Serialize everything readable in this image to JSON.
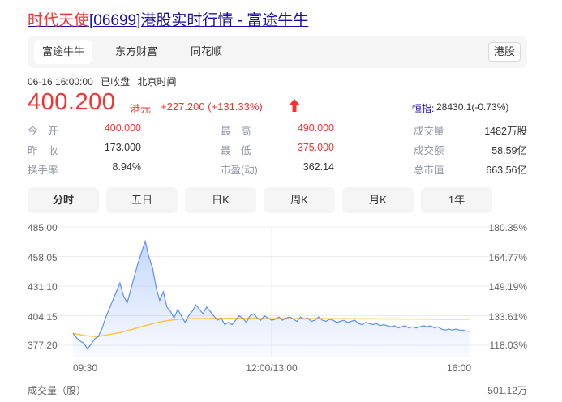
{
  "header": {
    "title_highlight": "时代天使",
    "title_rest": "[06699]港股实时行情 - 富途牛牛"
  },
  "source_tabs": [
    {
      "label": "富途牛牛",
      "active": true
    },
    {
      "label": "东方财富",
      "active": false
    },
    {
      "label": "同花顺",
      "active": false
    }
  ],
  "market_badge": "港股",
  "status": {
    "datetime": "06-16 16:00:00",
    "state": "已收盘",
    "timezone": "北京时间"
  },
  "quote": {
    "price": "400.200",
    "currency": "港元",
    "change": "+227.200 (+131.33%)",
    "direction": "up"
  },
  "index": {
    "label": "恒指:",
    "value": "28430.1(-0.73%)"
  },
  "stats": [
    {
      "label": "今　开",
      "value": "400.000",
      "red": true
    },
    {
      "label": "最　高",
      "value": "490.000",
      "red": true
    },
    {
      "label": "成交量",
      "value": "1482万股",
      "red": false
    },
    {
      "label": "昨　收",
      "value": "173.000",
      "red": false
    },
    {
      "label": "最　低",
      "value": "375.000",
      "red": true
    },
    {
      "label": "成交额",
      "value": "58.59亿",
      "red": false
    },
    {
      "label": "换手率",
      "value": "8.94%",
      "red": false
    },
    {
      "label": "市盈(动)",
      "value": "362.14",
      "red": false
    },
    {
      "label": "总市值",
      "value": "663.56亿",
      "red": false
    }
  ],
  "period_tabs": [
    {
      "label": "分时",
      "active": true
    },
    {
      "label": "五日",
      "active": false
    },
    {
      "label": "日K",
      "active": false
    },
    {
      "label": "周K",
      "active": false
    },
    {
      "label": "月K",
      "active": false
    },
    {
      "label": "1年",
      "active": false
    }
  ],
  "colors": {
    "up": "#f73131",
    "link": "#1a0dab",
    "price_line": "#5b8ff9",
    "avg_line": "#ffc53d"
  },
  "chart_data": {
    "type": "line",
    "y_left_ticks": [
      "485.00",
      "458.05",
      "431.10",
      "404.15",
      "377.20"
    ],
    "y_right_ticks": [
      "180.35%",
      "164.77%",
      "149.19%",
      "133.61%",
      "118.03%"
    ],
    "x_ticks": [
      "09:30",
      "12:00/13:00",
      "16:00"
    ],
    "ylim": [
      377.2,
      485.0
    ],
    "x_range": [
      0,
      330
    ],
    "grid": true,
    "volume_label": "成交量（股）",
    "volume_max": "501.12万",
    "series": [
      {
        "role": "price",
        "points": [
          [
            0,
            388
          ],
          [
            3,
            384
          ],
          [
            6,
            381
          ],
          [
            9,
            379
          ],
          [
            12,
            374
          ],
          [
            15,
            378
          ],
          [
            18,
            383
          ],
          [
            21,
            385
          ],
          [
            24,
            392
          ],
          [
            27,
            402
          ],
          [
            30,
            410
          ],
          [
            33,
            418
          ],
          [
            36,
            426
          ],
          [
            39,
            434
          ],
          [
            42,
            422
          ],
          [
            45,
            416
          ],
          [
            48,
            428
          ],
          [
            51,
            440
          ],
          [
            54,
            452
          ],
          [
            57,
            462
          ],
          [
            60,
            472
          ],
          [
            63,
            458
          ],
          [
            66,
            448
          ],
          [
            69,
            430
          ],
          [
            72,
            418
          ],
          [
            75,
            426
          ],
          [
            78,
            412
          ],
          [
            81,
            408
          ],
          [
            84,
            402
          ],
          [
            87,
            410
          ],
          [
            90,
            404
          ],
          [
            93,
            398
          ],
          [
            96,
            404
          ],
          [
            99,
            408
          ],
          [
            102,
            414
          ],
          [
            105,
            410
          ],
          [
            108,
            406
          ],
          [
            111,
            412
          ],
          [
            114,
            408
          ],
          [
            117,
            404
          ],
          [
            120,
            400
          ],
          [
            123,
            402
          ],
          [
            126,
            396
          ],
          [
            129,
            398
          ],
          [
            132,
            396
          ],
          [
            135,
            400
          ],
          [
            138,
            404
          ],
          [
            141,
            402
          ],
          [
            144,
            398
          ],
          [
            147,
            404
          ],
          [
            150,
            406
          ],
          [
            153,
            402
          ],
          [
            156,
            400
          ],
          [
            159,
            404
          ],
          [
            162,
            402
          ],
          [
            165,
            400
          ],
          [
            168,
            401
          ],
          [
            171,
            403
          ],
          [
            174,
            400
          ],
          [
            177,
            402
          ],
          [
            180,
            403
          ],
          [
            183,
            401
          ],
          [
            186,
            399
          ],
          [
            189,
            403
          ],
          [
            192,
            401
          ],
          [
            195,
            402
          ],
          [
            198,
            399
          ],
          [
            201,
            400
          ],
          [
            204,
            403
          ],
          [
            207,
            400
          ],
          [
            210,
            399
          ],
          [
            213,
            401
          ],
          [
            216,
            400
          ],
          [
            219,
            398
          ],
          [
            222,
            399
          ],
          [
            225,
            400
          ],
          [
            228,
            398
          ],
          [
            231,
            399
          ],
          [
            234,
            400
          ],
          [
            237,
            397
          ],
          [
            240,
            396
          ],
          [
            243,
            398
          ],
          [
            246,
            397
          ],
          [
            249,
            396
          ],
          [
            252,
            397
          ],
          [
            255,
            395
          ],
          [
            258,
            396
          ],
          [
            261,
            395
          ],
          [
            264,
            394
          ],
          [
            267,
            395
          ],
          [
            270,
            393
          ],
          [
            273,
            394
          ],
          [
            276,
            395
          ],
          [
            279,
            393
          ],
          [
            282,
            394
          ],
          [
            285,
            393
          ],
          [
            288,
            394
          ],
          [
            291,
            395
          ],
          [
            294,
            394
          ],
          [
            297,
            395
          ],
          [
            300,
            393
          ],
          [
            303,
            394
          ],
          [
            306,
            392
          ],
          [
            309,
            391
          ],
          [
            312,
            392
          ],
          [
            315,
            391
          ],
          [
            318,
            392
          ],
          [
            321,
            391
          ],
          [
            324,
            391
          ],
          [
            327,
            390
          ],
          [
            330,
            390
          ]
        ]
      },
      {
        "role": "average",
        "points": [
          [
            0,
            388
          ],
          [
            10,
            386
          ],
          [
            20,
            385
          ],
          [
            30,
            387
          ],
          [
            40,
            389
          ],
          [
            50,
            392
          ],
          [
            60,
            395
          ],
          [
            70,
            398
          ],
          [
            80,
            400
          ],
          [
            90,
            401
          ],
          [
            100,
            401.5
          ],
          [
            110,
            401.6
          ],
          [
            120,
            401.7
          ],
          [
            130,
            401.7
          ],
          [
            140,
            401.7
          ],
          [
            150,
            401.7
          ],
          [
            160,
            401.6
          ],
          [
            170,
            401.6
          ],
          [
            180,
            401.6
          ],
          [
            190,
            401.5
          ],
          [
            200,
            401.5
          ],
          [
            210,
            401.5
          ],
          [
            220,
            401.4
          ],
          [
            230,
            401.4
          ],
          [
            240,
            401.3
          ],
          [
            250,
            401.3
          ],
          [
            260,
            401.2
          ],
          [
            270,
            401.2
          ],
          [
            280,
            401.1
          ],
          [
            290,
            401.1
          ],
          [
            300,
            401.0
          ],
          [
            310,
            401.0
          ],
          [
            320,
            401.0
          ],
          [
            330,
            401.0
          ]
        ]
      }
    ]
  }
}
